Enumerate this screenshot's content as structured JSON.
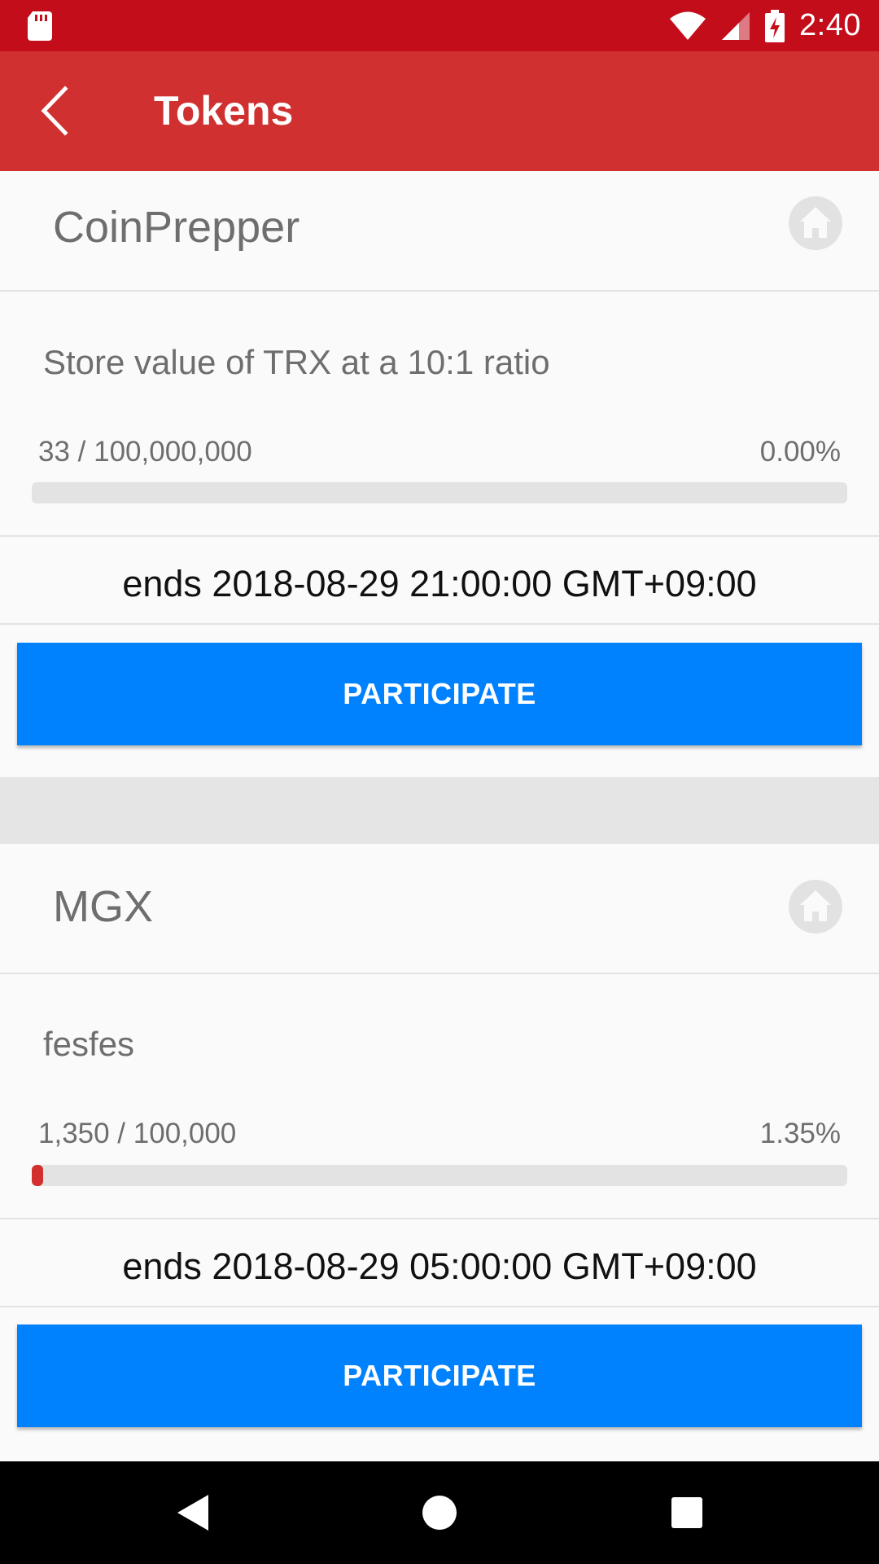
{
  "status_bar": {
    "time": "2:40",
    "icons": [
      "sd-card-icon",
      "wifi-icon",
      "cell-signal-icon",
      "battery-charging-icon"
    ]
  },
  "toolbar": {
    "title": "Tokens",
    "back_icon": "chevron-left-icon"
  },
  "tokens": [
    {
      "name": "CoinPrepper",
      "description": "Store value of TRX at a 10:1 ratio",
      "supply": "33 / 100,000,000",
      "percent": "0.00%",
      "progress": 0.0,
      "ends": "ends 2018-08-29 21:00:00 GMT+09:00",
      "button_label": "PARTICIPATE",
      "home_icon": "home-icon"
    },
    {
      "name": "MGX",
      "description": "fesfes",
      "supply": "1,350 / 100,000",
      "percent": "1.35%",
      "progress": 0.0135,
      "ends": "ends 2018-08-29 05:00:00 GMT+09:00",
      "button_label": "PARTICIPATE",
      "home_icon": "home-icon"
    }
  ],
  "nav_bar": {
    "icons": [
      "back-triangle-icon",
      "home-circle-icon",
      "recents-square-icon"
    ]
  },
  "colors": {
    "status_bar": "#c30d1b",
    "toolbar": "#d03030",
    "button": "#0082ff",
    "progress_fill": "#d32f2f",
    "progress_track": "#e3e3e3"
  }
}
